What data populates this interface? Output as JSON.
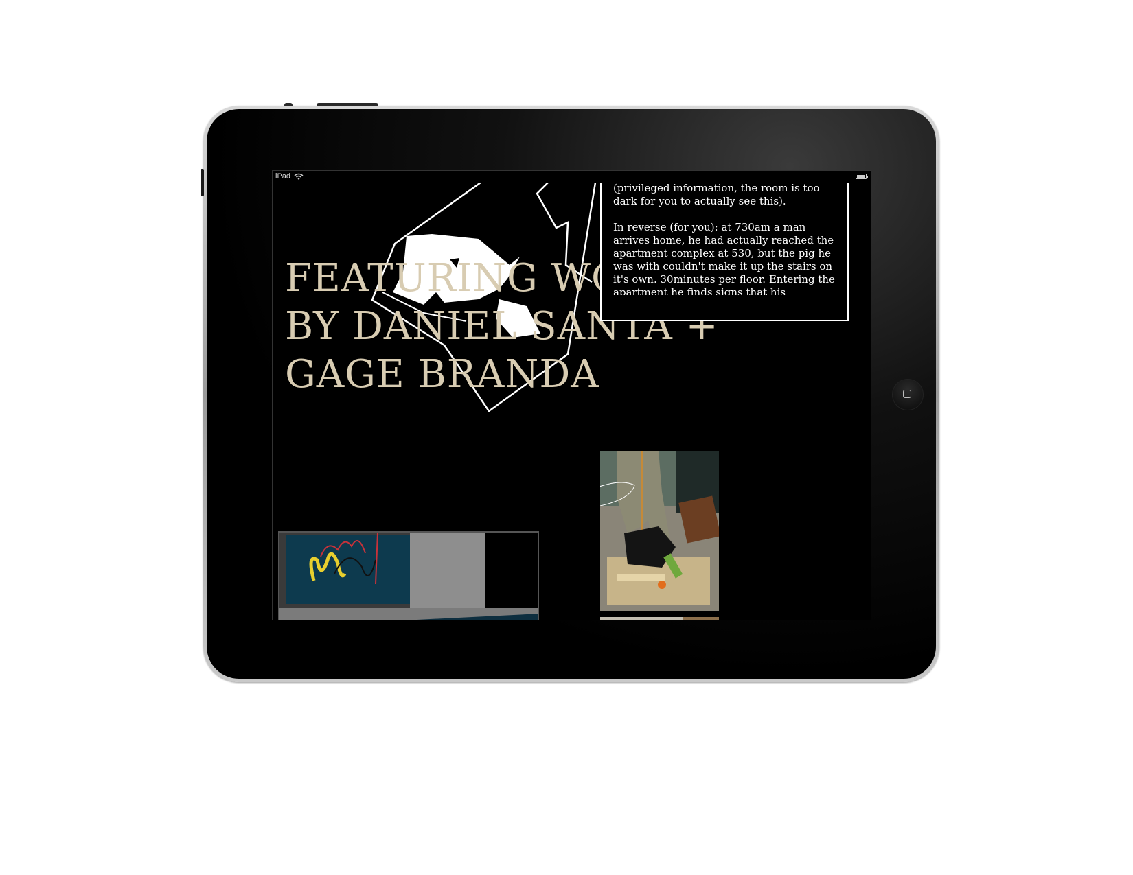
{
  "status_bar": {
    "device_label": "iPad",
    "wifi_icon": "wifi-icon",
    "battery_icon": "battery-icon"
  },
  "headline": {
    "line1": "FEATURING WO",
    "line2": "BY DANIEL SANTA +",
    "line3": "GAGE BRANDA"
  },
  "text_box": {
    "para1": "It is facing the wall wearing a birthday hat (privileged information, the room is too dark for you to actually see this).",
    "para2": "In reverse (for you): at 730am a man arrives home, he had actually reached the apartment complex at 530, but the pig he was with couldn't make it up the stairs on it's own. 30minutes per floor. Entering the apartment he finds signs that his"
  },
  "colors": {
    "headline": "#d8ccb2",
    "screen_background": "#000000",
    "text": "#ffffff"
  }
}
